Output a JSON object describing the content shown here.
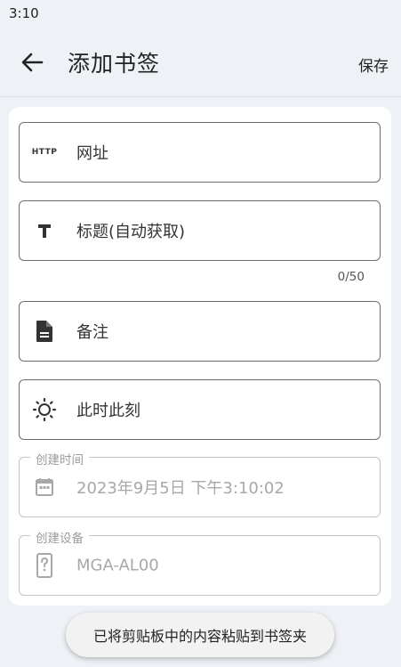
{
  "status_bar": {
    "time": "3:10"
  },
  "app_bar": {
    "title": "添加书签",
    "save_label": "保存"
  },
  "form": {
    "url": {
      "icon": "http-icon",
      "icon_text": "HTTP",
      "placeholder": "网址"
    },
    "title": {
      "icon": "text-icon",
      "placeholder": "标题(自动获取)",
      "counter": "0/50"
    },
    "note": {
      "icon": "document-icon",
      "placeholder": "备注"
    },
    "moment": {
      "icon": "sun-icon",
      "placeholder": "此时此刻"
    },
    "created_time": {
      "icon": "calendar-icon",
      "legend": "创建时间",
      "value": "2023年9月5日 下午3:10:02"
    },
    "created_device": {
      "icon": "device-unknown-icon",
      "legend": "创建设备",
      "value": "MGA-AL00"
    }
  },
  "toast": {
    "message": "已将剪贴板中的内容粘贴到书签夹"
  },
  "colors": {
    "background": "#eef1f5",
    "card": "#ffffff",
    "outline": "#6e6e6e",
    "disabled": "#a8a8a8"
  }
}
